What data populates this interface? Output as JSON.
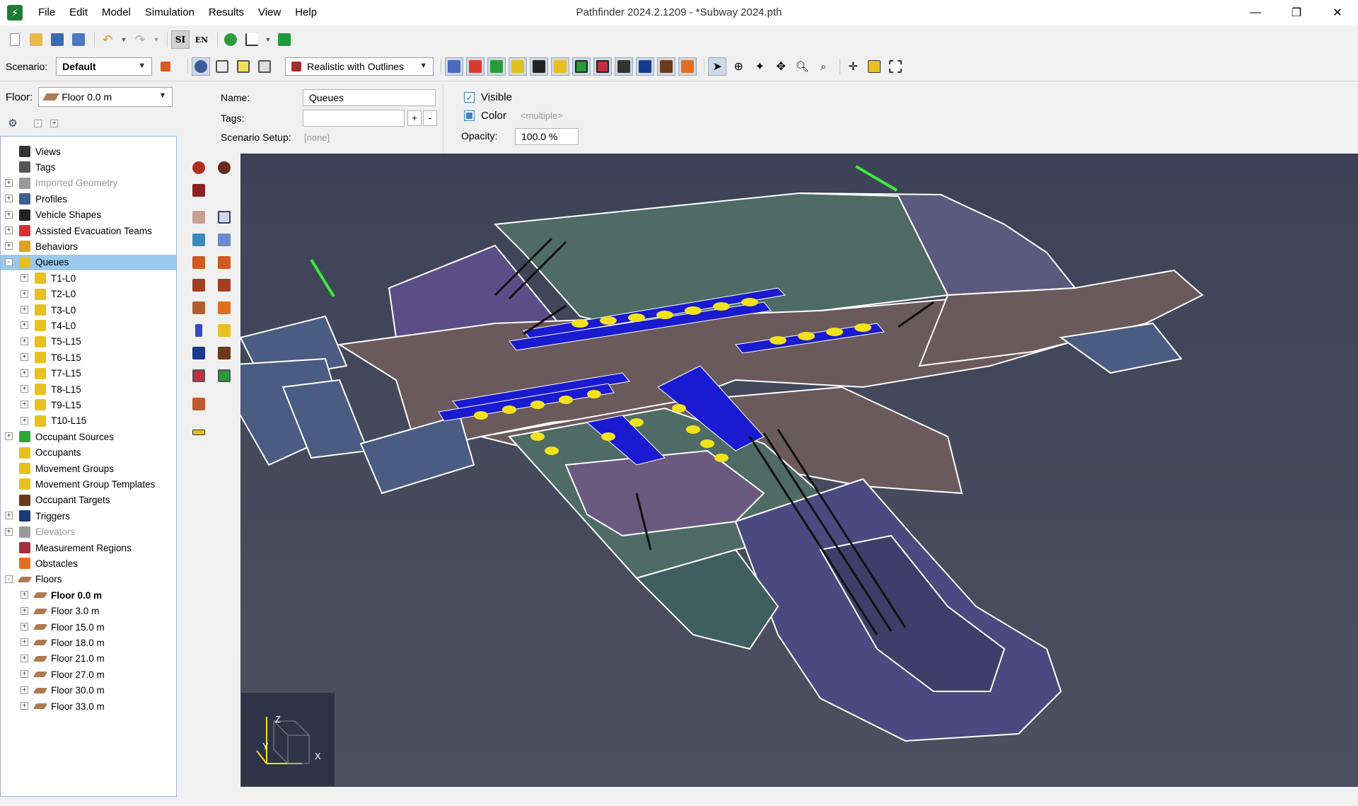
{
  "window": {
    "title": "Pathfinder 2024.2.1209 - *Subway 2024.pth",
    "menu": [
      "File",
      "Edit",
      "Model",
      "Simulation",
      "Results",
      "View",
      "Help"
    ],
    "controls": [
      "—",
      "❐",
      "✕"
    ]
  },
  "toolbar": {
    "scenario_label": "Scenario:",
    "scenario_value": "Default",
    "view_mode": "Realistic with Outlines",
    "si_label": "SI",
    "en_label": "EN"
  },
  "floor_selector": {
    "label": "Floor:",
    "value": "Floor 0.0 m"
  },
  "properties": {
    "name_label": "Name:",
    "name_value": "Queues",
    "tags_label": "Tags:",
    "tags_value": "",
    "scenario_setup_label": "Scenario Setup:",
    "scenario_setup_value": "[none]",
    "visible_label": "Visible",
    "color_label": "Color",
    "color_value": "<multiple>",
    "opacity_label": "Opacity:",
    "opacity_value": "100.0 %",
    "plus": "+",
    "minus": "-"
  },
  "tree": {
    "expand_all": "-",
    "collapse_all": "+",
    "items": [
      {
        "label": "Views",
        "icon": "camera-icon",
        "exp": "",
        "level": 0,
        "color": "#333333"
      },
      {
        "label": "Tags",
        "icon": "tag-icon",
        "exp": "",
        "level": 0,
        "color": "#555555"
      },
      {
        "label": "Imported Geometry",
        "icon": "geometry-icon",
        "exp": "+",
        "level": 0,
        "color": "#9a9a9a",
        "gray": true
      },
      {
        "label": "Profiles",
        "icon": "profile-icon",
        "exp": "+",
        "level": 0,
        "color": "#3b5f8f"
      },
      {
        "label": "Vehicle Shapes",
        "icon": "wheelchair-icon",
        "exp": "+",
        "level": 0,
        "color": "#222222"
      },
      {
        "label": "Assisted Evacuation Teams",
        "icon": "team-icon",
        "exp": "+",
        "level": 0,
        "color": "#d83030"
      },
      {
        "label": "Behaviors",
        "icon": "behavior-icon",
        "exp": "+",
        "level": 0,
        "color": "#e0a020"
      },
      {
        "label": "Queues",
        "icon": "queue-icon",
        "exp": "-",
        "level": 0,
        "color": "#e8c020",
        "selected": true
      },
      {
        "label": "T1-L0",
        "icon": "queue-icon",
        "exp": "+",
        "level": 1,
        "color": "#e8c020"
      },
      {
        "label": "T2-L0",
        "icon": "queue-icon",
        "exp": "+",
        "level": 1,
        "color": "#e8c020"
      },
      {
        "label": "T3-L0",
        "icon": "queue-icon",
        "exp": "+",
        "level": 1,
        "color": "#e8c020"
      },
      {
        "label": "T4-L0",
        "icon": "queue-icon",
        "exp": "+",
        "level": 1,
        "color": "#e8c020"
      },
      {
        "label": "T5-L15",
        "icon": "queue-icon",
        "exp": "+",
        "level": 1,
        "color": "#e8c020"
      },
      {
        "label": "T6-L15",
        "icon": "queue-icon",
        "exp": "+",
        "level": 1,
        "color": "#e8c020"
      },
      {
        "label": "T7-L15",
        "icon": "queue-icon",
        "exp": "+",
        "level": 1,
        "color": "#e8c020"
      },
      {
        "label": "T8-L15",
        "icon": "queue-icon",
        "exp": "+",
        "level": 1,
        "color": "#e8c020"
      },
      {
        "label": "T9-L15",
        "icon": "queue-icon",
        "exp": "+",
        "level": 1,
        "color": "#e8c020"
      },
      {
        "label": "T10-L15",
        "icon": "queue-icon",
        "exp": "+",
        "level": 1,
        "color": "#e8c020"
      },
      {
        "label": "Occupant Sources",
        "icon": "source-icon",
        "exp": "+",
        "level": 0,
        "color": "#2aa836"
      },
      {
        "label": "Occupants",
        "icon": "occupants-icon",
        "exp": "",
        "level": 0,
        "color": "#e8c020"
      },
      {
        "label": "Movement Groups",
        "icon": "group-icon",
        "exp": "",
        "level": 0,
        "color": "#e8c020"
      },
      {
        "label": "Movement Group Templates",
        "icon": "group-template-icon",
        "exp": "",
        "level": 0,
        "color": "#e8c020"
      },
      {
        "label": "Occupant Targets",
        "icon": "target-icon",
        "exp": "",
        "level": 0,
        "color": "#6a3a1a"
      },
      {
        "label": "Triggers",
        "icon": "trigger-icon",
        "exp": "+",
        "level": 0,
        "color": "#1a3a7a"
      },
      {
        "label": "Elevators",
        "icon": "elevator-icon",
        "exp": "+",
        "level": 0,
        "color": "#9a9a9a",
        "gray": true
      },
      {
        "label": "Measurement Regions",
        "icon": "measurement-icon",
        "exp": "",
        "level": 0,
        "color": "#a03040"
      },
      {
        "label": "Obstacles",
        "icon": "cone-icon",
        "exp": "",
        "level": 0,
        "color": "#e07020"
      },
      {
        "label": "Floors",
        "icon": "floor-icon",
        "exp": "-",
        "level": 0,
        "color": "#b07a50"
      },
      {
        "label": "Floor 0.0 m",
        "icon": "floor-icon",
        "exp": "+",
        "level": 1,
        "color": "#b07a50",
        "bold": true
      },
      {
        "label": "Floor 3.0 m",
        "icon": "floor-icon",
        "exp": "+",
        "level": 1,
        "color": "#b07a50"
      },
      {
        "label": "Floor 15.0 m",
        "icon": "floor-icon",
        "exp": "+",
        "level": 1,
        "color": "#b07a50"
      },
      {
        "label": "Floor 18.0 m",
        "icon": "floor-icon",
        "exp": "+",
        "level": 1,
        "color": "#b07a50"
      },
      {
        "label": "Floor 21.0 m",
        "icon": "floor-icon",
        "exp": "+",
        "level": 1,
        "color": "#b07a50"
      },
      {
        "label": "Floor 27.0 m",
        "icon": "floor-icon",
        "exp": "+",
        "level": 1,
        "color": "#b07a50"
      },
      {
        "label": "Floor 30.0 m",
        "icon": "floor-icon",
        "exp": "+",
        "level": 1,
        "color": "#b07a50"
      },
      {
        "label": "Floor 33.0 m",
        "icon": "floor-icon",
        "exp": "+",
        "level": 1,
        "color": "#b07a50"
      }
    ]
  },
  "axis": {
    "x": "X",
    "y": "Y",
    "z": "Z"
  },
  "colors": {
    "floor_brown": "#6b5a5c",
    "room_teal": "#4f6b66",
    "room_purple": "#5b4d86",
    "room_blue": "#4a5c82",
    "platform_blue": "#1a1ad0",
    "occupant_yellow": "#f2e21c",
    "marker_green": "#3de83d",
    "selection": "#99c9ef"
  }
}
